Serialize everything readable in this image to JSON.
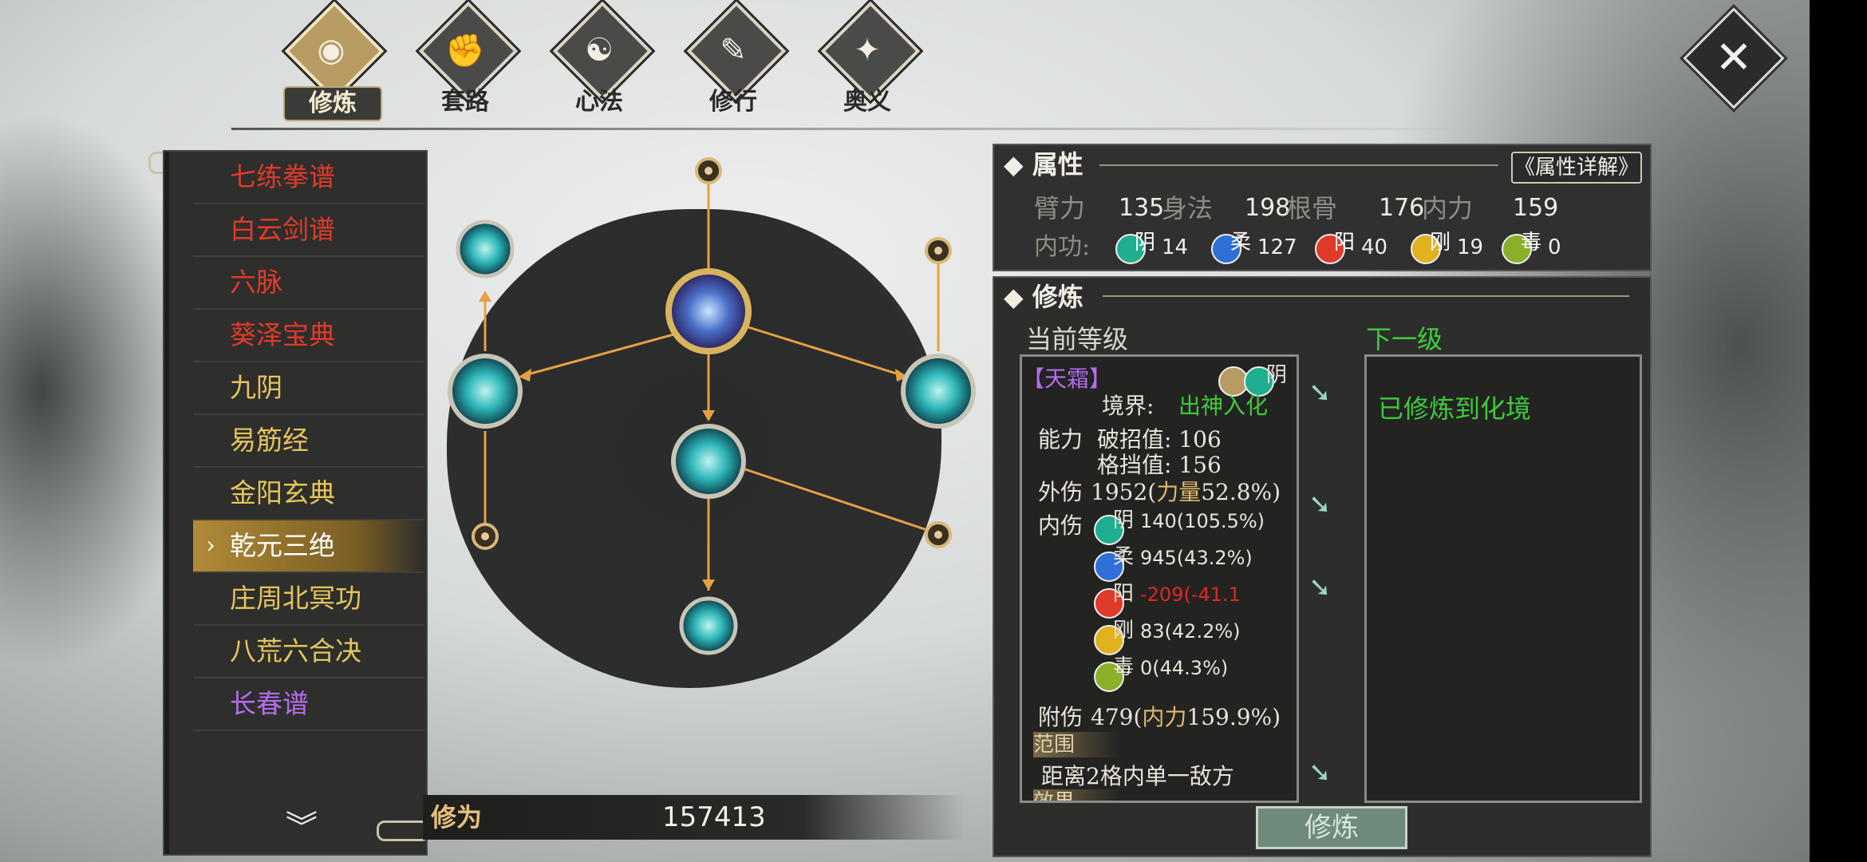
{
  "tabs": [
    {
      "label": "修炼",
      "glyph": "◉",
      "icon": "flame-icon",
      "active": true
    },
    {
      "label": "套路",
      "glyph": "✊",
      "icon": "fist-icon",
      "active": false
    },
    {
      "label": "心法",
      "glyph": "☯",
      "icon": "swirl-icon",
      "active": false
    },
    {
      "label": "修行",
      "glyph": "✎",
      "icon": "brush-icon",
      "active": false
    },
    {
      "label": "奥义",
      "glyph": "✦",
      "icon": "crest-icon",
      "active": false
    }
  ],
  "close_glyph": "✕",
  "skill_list": [
    {
      "name": "七练拳谱",
      "color": "#e23a2a",
      "selected": false
    },
    {
      "name": "白云剑谱",
      "color": "#e23a2a",
      "selected": false
    },
    {
      "name": "六脉",
      "color": "#e23a2a",
      "selected": false
    },
    {
      "name": "葵泽宝典",
      "color": "#e23a2a",
      "selected": false
    },
    {
      "name": "九阴",
      "color": "#e6c55a",
      "selected": false
    },
    {
      "name": "易筋经",
      "color": "#e6c55a",
      "selected": false
    },
    {
      "name": "金阳玄典",
      "color": "#e6c55a",
      "selected": false
    },
    {
      "name": "乾元三绝",
      "color": "#ffffff",
      "selected": true
    },
    {
      "name": "庄周北冥功",
      "color": "#e6c55a",
      "selected": false
    },
    {
      "name": "八荒六合决",
      "color": "#e6c55a",
      "selected": false
    },
    {
      "name": "长春谱",
      "color": "#b56cf0",
      "selected": false
    }
  ],
  "list_arrow": "›",
  "list_down": "︾",
  "xiuwei": {
    "label": "修为",
    "value": "157413"
  },
  "attributes": {
    "title": "属性",
    "detail_button": "《属性详解》",
    "stats": [
      {
        "name": "臂力",
        "value": "135"
      },
      {
        "name": "身法",
        "value": "198"
      },
      {
        "name": "根骨",
        "value": "176"
      },
      {
        "name": "内力",
        "value": "159"
      }
    ],
    "neigong_label": "内功:",
    "neigong": [
      {
        "char": "阴",
        "value": "14",
        "color": "#1fae8f"
      },
      {
        "char": "柔",
        "value": "127",
        "color": "#2f6fd8"
      },
      {
        "char": "阳",
        "value": "40",
        "color": "#e03a2a"
      },
      {
        "char": "刚",
        "value": "19",
        "color": "#e0b21f"
      },
      {
        "char": "毒",
        "value": "0",
        "color": "#8ab02a"
      }
    ]
  },
  "xiulian": {
    "title": "修炼",
    "current_label": "当前等级",
    "next_label": "下一级",
    "skill_name": "【天霜】",
    "skill_attr": "阴",
    "realm_label": "境界:",
    "realm_value": "出神入化",
    "ability_label": "能力",
    "pozhao": "破招值:  106",
    "gedang": "格挡值:  156",
    "waishang_label": "外伤",
    "waishang_value": "1952(",
    "waishang_stat": "力量",
    "waishang_pct": "52.8%)",
    "neishang_label": "内伤",
    "neishang": [
      {
        "char": "阴",
        "text": "140(105.5%)",
        "color": "#1fae8f",
        "text_color": "#e8e4da"
      },
      {
        "char": "柔",
        "text": "945(43.2%)",
        "color": "#2f6fd8",
        "text_color": "#e8e4da"
      },
      {
        "char": "阳",
        "text": "-209(-41.1",
        "color": "#e03a2a",
        "text_color": "#e02626"
      },
      {
        "char": "刚",
        "text": "83(42.2%)",
        "color": "#e0b21f",
        "text_color": "#e8e4da"
      },
      {
        "char": "毒",
        "text": "0(44.3%)",
        "color": "#8ab02a",
        "text_color": "#e8e4da"
      }
    ],
    "fushang_label": "附伤",
    "fushang_value": "479(",
    "fushang_stat": "内力",
    "fushang_pct": "159.9%)",
    "range_tag": "范围",
    "range_text": "距离2格内单一敌方",
    "effect_tag": "效果",
    "next_text": "已修炼到化境",
    "forward_arrow": "➘",
    "button": "修炼"
  },
  "colors": {
    "accent_gold": "#e0b96a",
    "orange_line": "#e8a040",
    "green": "#3ecb3a",
    "red": "#e02626"
  }
}
